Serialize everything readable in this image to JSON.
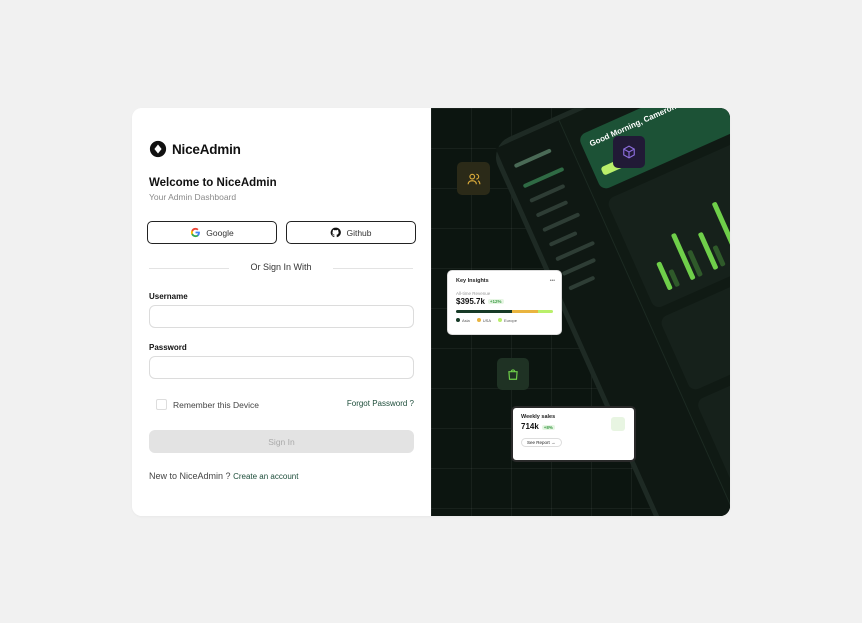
{
  "brand": {
    "name": "NiceAdmin"
  },
  "header": {
    "title": "Welcome to NiceAdmin",
    "subtitle": "Your Admin Dashboard"
  },
  "social": {
    "google_label": "Google",
    "github_label": "Github"
  },
  "divider_text": "Or Sign In With",
  "form": {
    "username_label": "Username",
    "username_value": "",
    "password_label": "Password",
    "password_value": "",
    "remember_label": "Remember this Device",
    "remember_checked": false,
    "forgot_label": "Forgot Password ?",
    "signin_label": "Sign In"
  },
  "footer": {
    "prompt": "New to NiceAdmin ?",
    "link": "Create an account"
  },
  "preview": {
    "greeting": "Good Morning, Cameron",
    "insights_card": {
      "title": "Key Insights",
      "more": "•••",
      "label": "All-time Revenue",
      "value": "$395.7k",
      "badge": "+12%",
      "legend": [
        "Asia",
        "USA",
        "Europe"
      ]
    },
    "sales_card": {
      "title": "Weekly sales",
      "value": "714k",
      "badge": "+8%",
      "button": "See Report →"
    }
  },
  "colors": {
    "accent": "#1d4d3a",
    "dark_panel": "#0c1510",
    "chart_green": "#6fcf4a",
    "input_border": "#dcdcdc",
    "button_disabled": "#e3e3e3"
  }
}
